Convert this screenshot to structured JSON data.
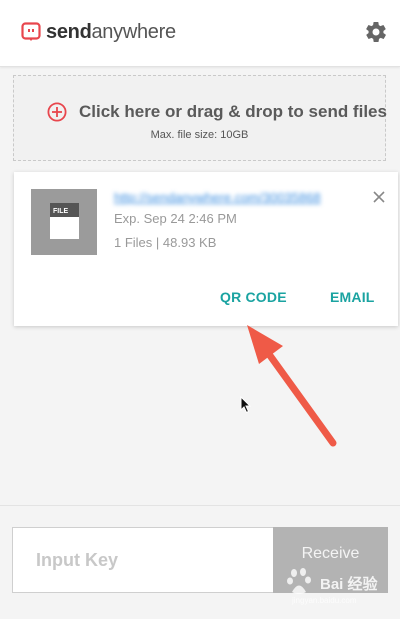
{
  "header": {
    "logo_send": "send",
    "logo_anywhere": "anywhere",
    "logo_icon": "send-anywhere-logo-icon",
    "settings_icon": "gear-icon"
  },
  "dropzone": {
    "title": "Click here or drag & drop to send files",
    "subtitle": "Max. file size: 10GB",
    "icon": "plus-circle-icon"
  },
  "file_card": {
    "link": "http://sendanywhere.com/30035868",
    "expiry": "Exp. Sep 24 2:46 PM",
    "meta": "1 Files | 48.93 KB",
    "thumb_label": "FILE",
    "qr_label": "QR CODE",
    "email_label": "EMAIL"
  },
  "receive": {
    "placeholder": "Input Key",
    "button_label": "Receive"
  },
  "watermark": {
    "text": "Bai 经验",
    "sub": "jingyan.baidu.com"
  },
  "colors": {
    "accent": "#1aa3a1",
    "logo_red": "#e8464d",
    "annotation_arrow": "#ef5a47",
    "receive_bg": "#b3b3b3"
  }
}
